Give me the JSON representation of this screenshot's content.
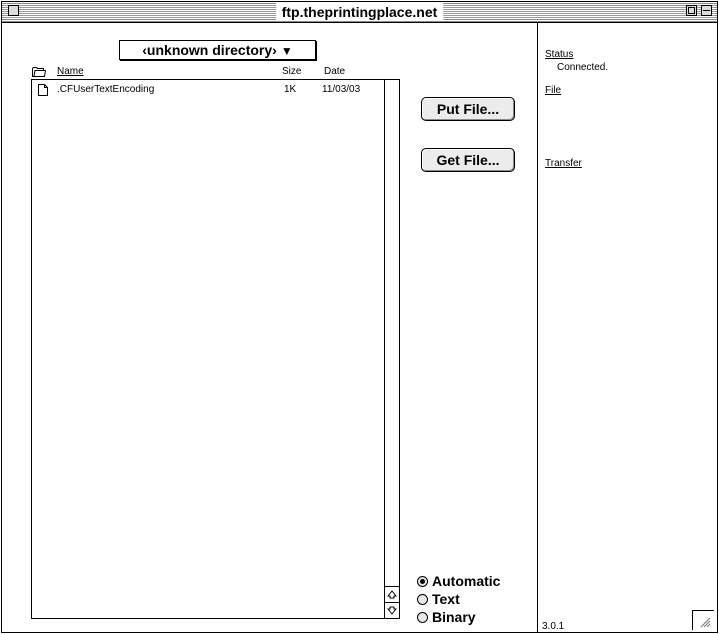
{
  "window": {
    "title": "ftp.theprintingplace.net"
  },
  "directory": {
    "popup_label": "‹unknown directory›",
    "arrow": "▼"
  },
  "columns": {
    "name": "Name",
    "size": "Size",
    "date": "Date"
  },
  "files": [
    {
      "name": ".CFUserTextEncoding",
      "size": "1K",
      "date": "11/03/03",
      "icon": "document-icon"
    }
  ],
  "buttons": {
    "put": "Put File...",
    "get": "Get File..."
  },
  "transfer_mode": {
    "options": [
      "Automatic",
      "Text",
      "Binary"
    ],
    "selected": "Automatic"
  },
  "status_panel": {
    "status_label": "Status",
    "status_value": "Connected.",
    "file_label": "File",
    "transfer_label": "Transfer",
    "version": "3.0.1"
  }
}
